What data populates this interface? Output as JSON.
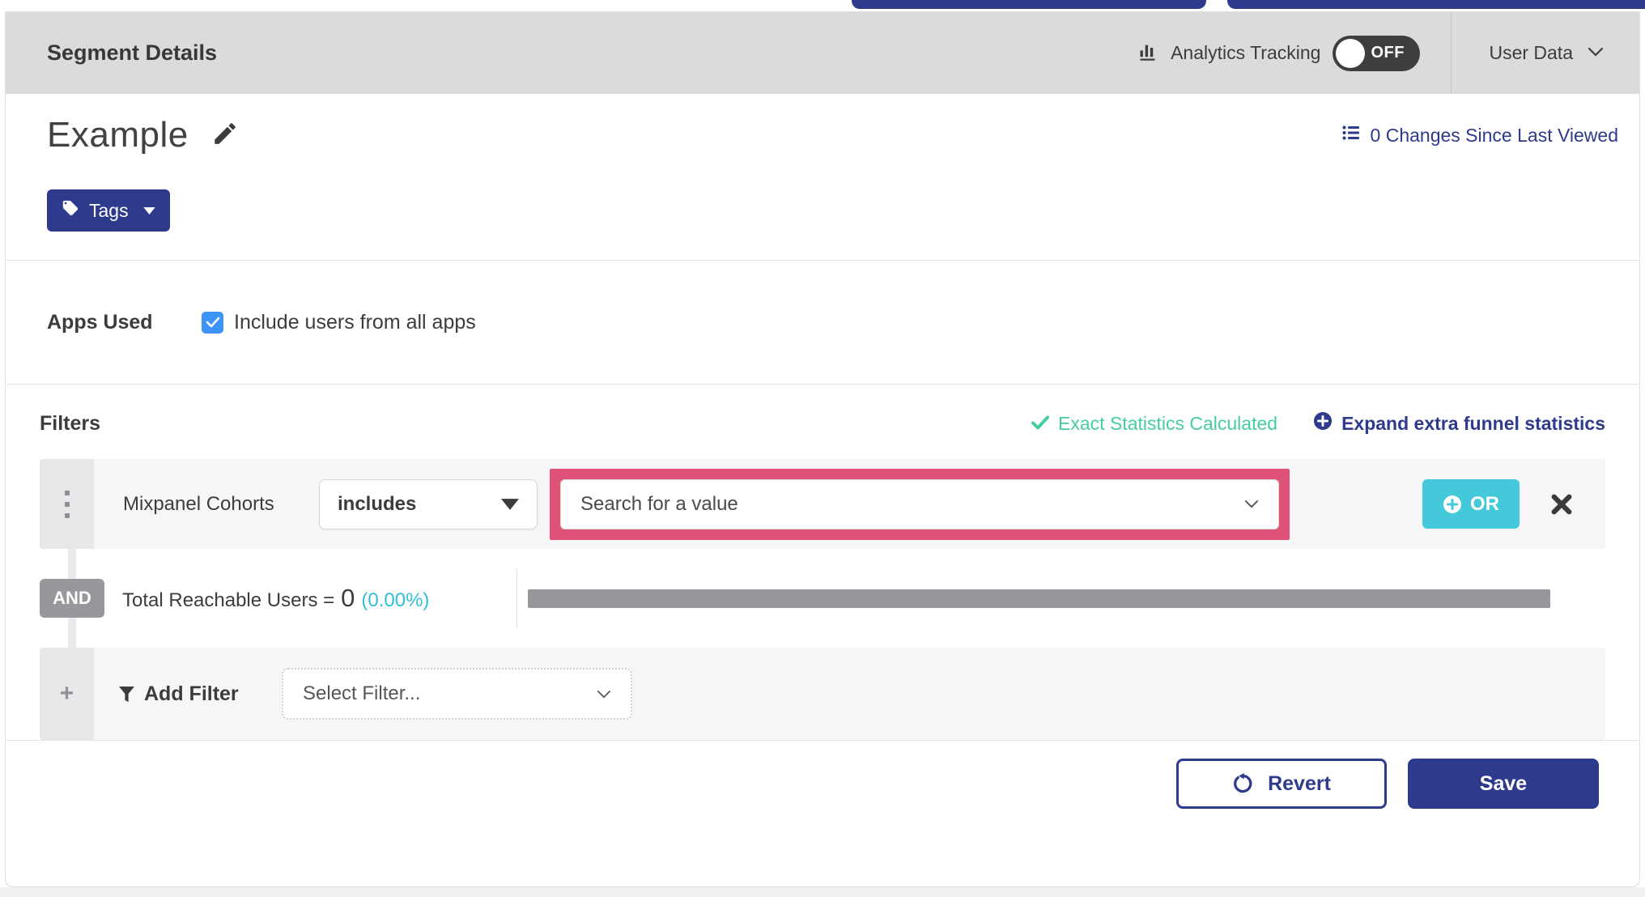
{
  "header": {
    "title": "Segment Details",
    "analytics_tracking": {
      "label": "Analytics Tracking",
      "state": "OFF"
    },
    "user_data": {
      "label": "User Data"
    }
  },
  "segment": {
    "name": "Example",
    "tags_button": "Tags",
    "changes_link": "0 Changes Since Last Viewed"
  },
  "apps_used": {
    "label": "Apps Used",
    "include_all_label": "Include users from all apps",
    "include_all_checked": true
  },
  "filters": {
    "heading": "Filters",
    "status_exact": "Exact Statistics Calculated",
    "expand_link": "Expand extra funnel statistics",
    "rows": [
      {
        "field": "Mixpanel Cohorts",
        "operator": "includes",
        "value_placeholder": "Search for a value",
        "or_button": "OR"
      }
    ],
    "conjunction": "AND",
    "reachable": {
      "label": "Total Reachable Users =",
      "value": "0",
      "percent": "(0.00%)",
      "bar_fill_percent": 0
    },
    "add_filter": {
      "label": "Add Filter",
      "placeholder": "Select Filter..."
    }
  },
  "footer": {
    "revert": "Revert",
    "save": "Save"
  },
  "colors": {
    "navy": "#2e3a8c",
    "teal_button": "#43c9d9",
    "teal_text": "#2fc0d6",
    "green_status": "#45cda1",
    "highlight_pink": "#e05278",
    "gray_badge": "#98989c",
    "checkbox_blue": "#3d94f6",
    "header_gray": "#dbdbde"
  }
}
